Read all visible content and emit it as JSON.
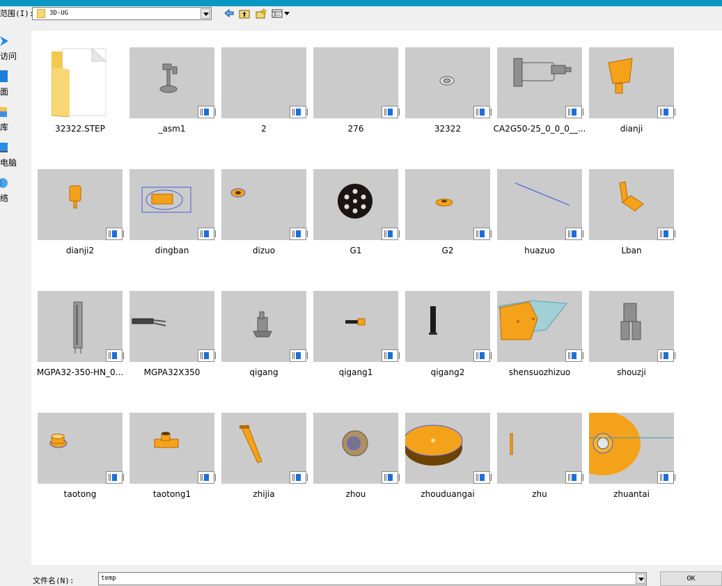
{
  "toolbar": {
    "look_in_label": "范围(I):",
    "look_in_value": "3D-UG",
    "back_icon": "back-arrow-icon",
    "up_icon": "up-folder-icon",
    "new_folder_icon": "new-folder-icon",
    "view_menu_icon": "view-menu-icon"
  },
  "places": [
    {
      "label": "访问",
      "icon": "star-icon"
    },
    {
      "label": "面",
      "icon": "desktop-icon"
    },
    {
      "label": "库",
      "icon": "library-icon"
    },
    {
      "label": "电脑",
      "icon": "computer-icon"
    },
    {
      "label": "络",
      "icon": "network-icon"
    }
  ],
  "files": [
    {
      "name": "32322.STEP",
      "kind": "folder"
    },
    {
      "name": "_asm1",
      "kind": "part"
    },
    {
      "name": "2",
      "kind": "part"
    },
    {
      "name": "276",
      "kind": "part"
    },
    {
      "name": "32322",
      "kind": "part"
    },
    {
      "name": "CA2G50-25_0_0_0__...",
      "kind": "part"
    },
    {
      "name": "dianji",
      "kind": "part"
    },
    {
      "name": "dianji2",
      "kind": "part"
    },
    {
      "name": "dingban",
      "kind": "part"
    },
    {
      "name": "dizuo",
      "kind": "part"
    },
    {
      "name": "G1",
      "kind": "part"
    },
    {
      "name": "G2",
      "kind": "part"
    },
    {
      "name": "huazuo",
      "kind": "part"
    },
    {
      "name": "Lban",
      "kind": "part"
    },
    {
      "name": "MGPA32-350-HN_0...",
      "kind": "part"
    },
    {
      "name": "MGPA32X350",
      "kind": "part"
    },
    {
      "name": "qigang",
      "kind": "part"
    },
    {
      "name": "qigang1",
      "kind": "part"
    },
    {
      "name": "qigang2",
      "kind": "part"
    },
    {
      "name": "shensuozhizuo",
      "kind": "part"
    },
    {
      "name": "shouzji",
      "kind": "part"
    },
    {
      "name": "taotong",
      "kind": "part"
    },
    {
      "name": "taotong1",
      "kind": "part"
    },
    {
      "name": "zhijia",
      "kind": "part"
    },
    {
      "name": "zhou",
      "kind": "part"
    },
    {
      "name": "zhouduangai",
      "kind": "part"
    },
    {
      "name": "zhu",
      "kind": "part"
    },
    {
      "name": "zhuantai",
      "kind": "part"
    }
  ],
  "footer": {
    "filename_label": "文件名(N):",
    "filename_value": "temp",
    "ok_label": "OK"
  },
  "colors": {
    "title_bar": "#0a97c2",
    "thumb_bg": "#cbcbcb",
    "part_orange": "#f5a21b",
    "part_gray": "#9a9a9a"
  }
}
